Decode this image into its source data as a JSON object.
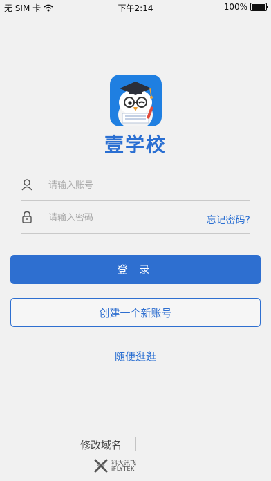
{
  "status_bar": {
    "carrier": "无 SIM 卡",
    "time": "下午2:14",
    "battery_text": "100%",
    "battery_level": 1.0
  },
  "brand": {
    "name": "壹学校"
  },
  "login_form": {
    "username_placeholder": "请输入账号",
    "password_placeholder": "请输入密码",
    "forgot_password": "忘记密码?",
    "login_button": "登 录",
    "register_button": "创建一个新账号",
    "browse_link": "随便逛逛"
  },
  "footer": {
    "change_domain": "修改域名",
    "logo_cn": "科大讯飞",
    "logo_en": "iFLYTEK"
  },
  "colors": {
    "accent": "#2e6fd0",
    "background": "#f1f1f1",
    "logo_blue": "#1f7fe1"
  }
}
